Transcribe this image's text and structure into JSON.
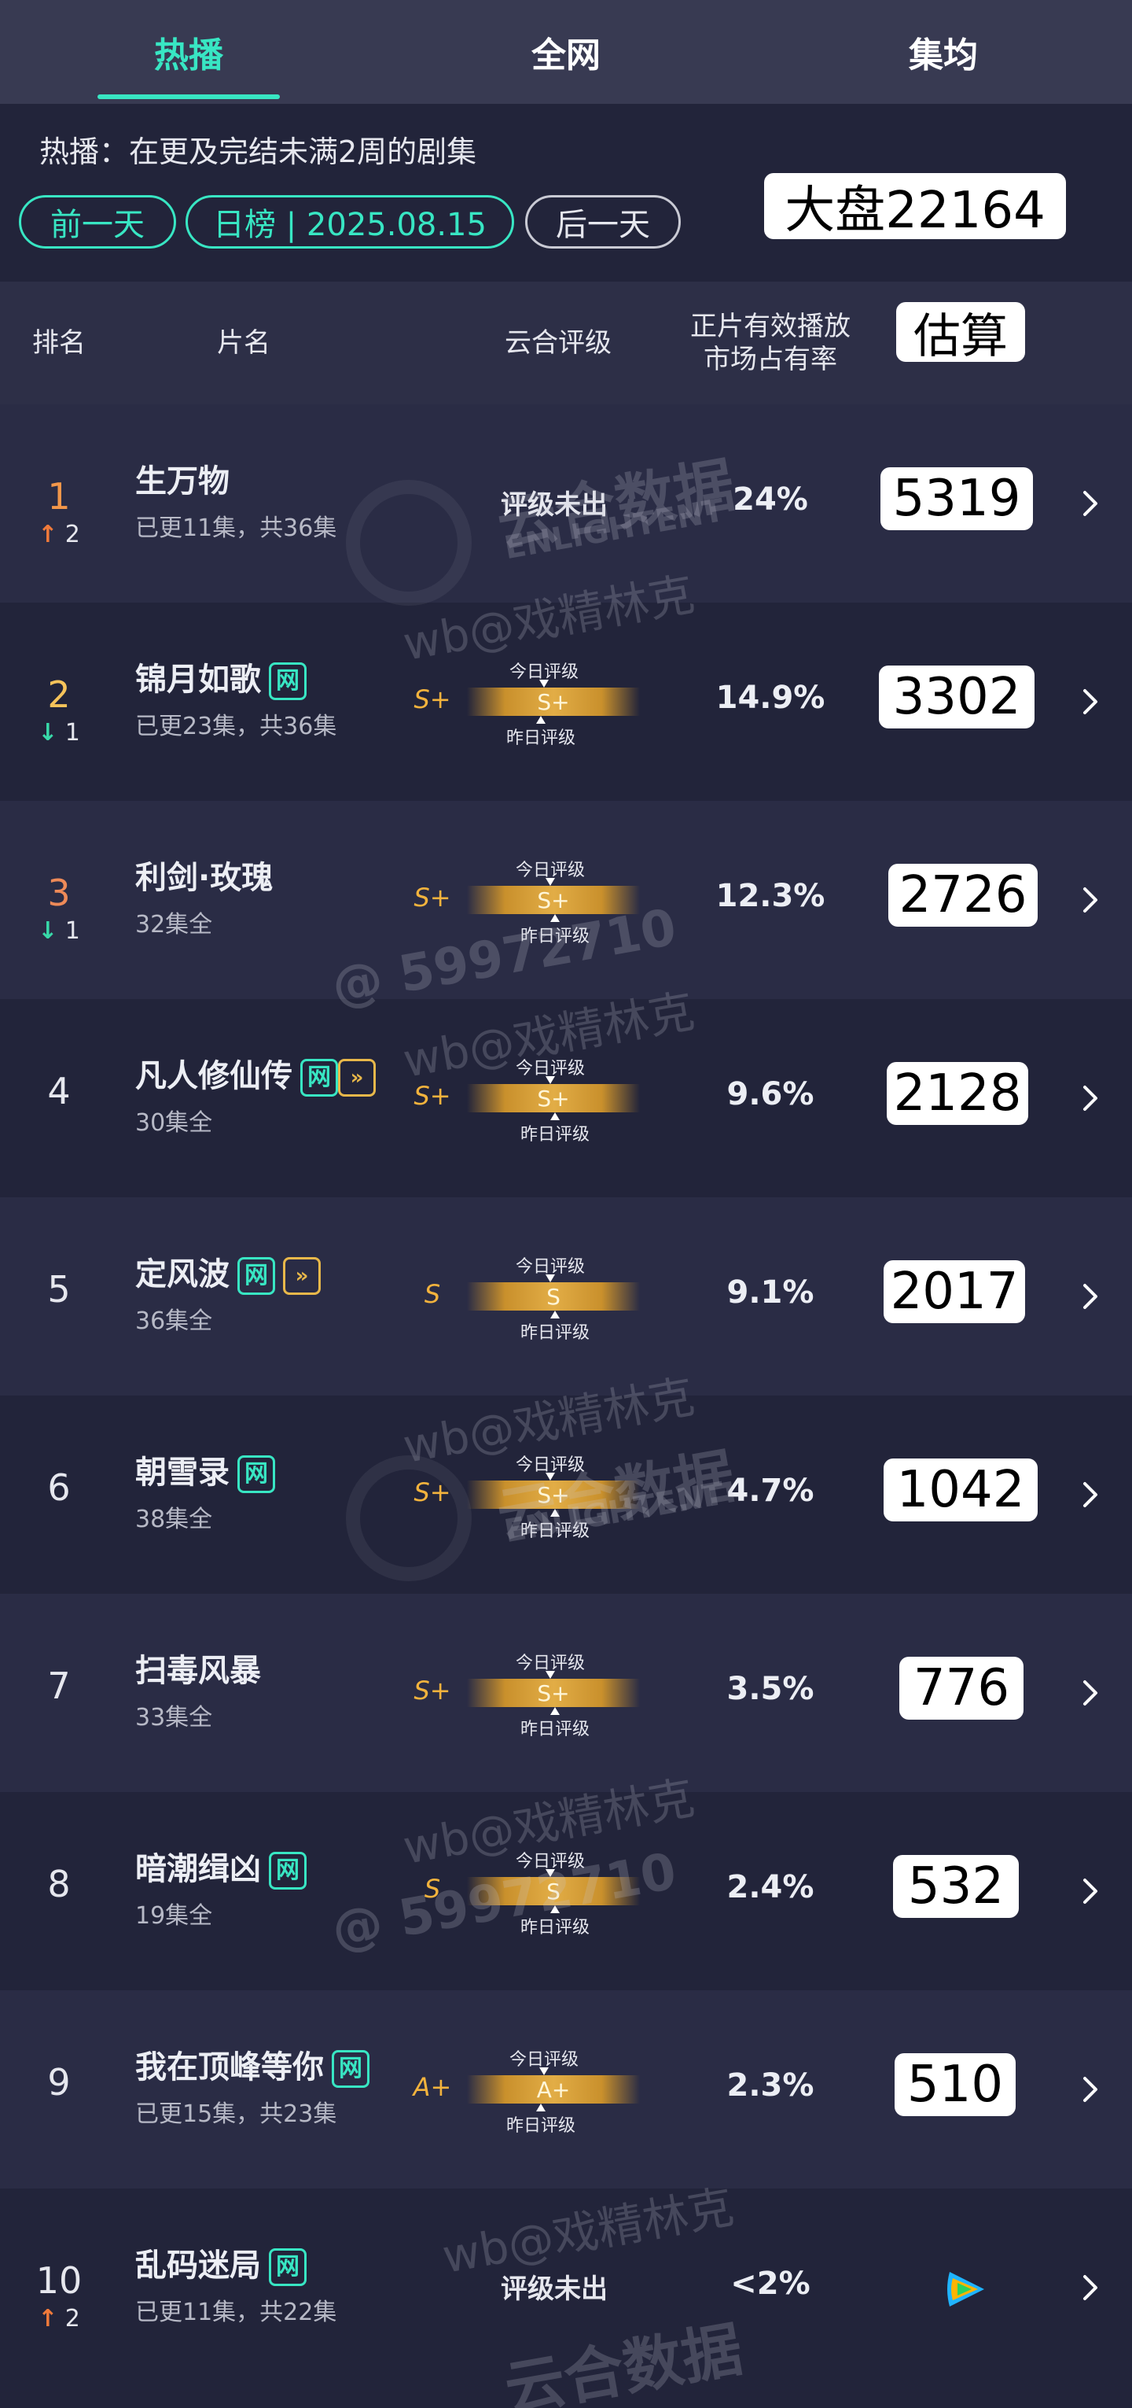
{
  "tabs": [
    {
      "label": "热播",
      "active": true
    },
    {
      "label": "全网",
      "active": false
    },
    {
      "label": "集均",
      "active": false
    }
  ],
  "info": {
    "subtitle": "热播：在更及完结未满2周的剧集",
    "prev_label": "前一天",
    "date_label": "日榜 | 2025.08.15",
    "next_label": "后一天",
    "total_overlay": "大盘22164"
  },
  "columns": {
    "rank": "排名",
    "name": "片名",
    "rating": "云合评级",
    "share": "正片有效播放\n市场占有率",
    "estimate_overlay": "估算"
  },
  "labels": {
    "today": "今日评级",
    "yesterday": "昨日评级"
  },
  "watermark": {
    "text": "wb@戏精林克",
    "brand": "云合数据",
    "brand_en": "ENLIGHTENT",
    "id_fragment": "@ 59972710"
  },
  "colors": {
    "accent": "#38e6c3",
    "rank_up": "#f07a3a",
    "rank_down": "#38d9a9",
    "grade": "#f3b33d"
  },
  "rows": [
    {
      "rank": "1",
      "change_dir": "up",
      "change": "2",
      "title": "生万物",
      "badges": [],
      "episodes": "已更11集，共36集",
      "rating": null,
      "no_rating": "评级未出",
      "share": "24%",
      "estimate": "5319"
    },
    {
      "rank": "2",
      "change_dir": "down",
      "change": "1",
      "title": "锦月如歌",
      "badges": [
        "网"
      ],
      "episodes": "已更23集，共36集",
      "rating": "S+",
      "share": "14.9%",
      "estimate": "3302"
    },
    {
      "rank": "3",
      "change_dir": "down",
      "change": "1",
      "title": "利剑·玫瑰",
      "badges": [],
      "episodes": "32集全",
      "rating": "S+",
      "share": "12.3%",
      "estimate": "2726"
    },
    {
      "rank": "4",
      "change_dir": "",
      "change": "",
      "title": "凡人修仙传",
      "badges": [
        "网",
        "play"
      ],
      "episodes": "30集全",
      "rating": "S+",
      "share": "9.6%",
      "estimate": "2128"
    },
    {
      "rank": "5",
      "change_dir": "",
      "change": "",
      "title": "定风波",
      "badges": [
        "网",
        "play"
      ],
      "episodes": "36集全",
      "rating": "S",
      "share": "9.1%",
      "estimate": "2017"
    },
    {
      "rank": "6",
      "change_dir": "",
      "change": "",
      "title": "朝雪录",
      "badges": [
        "网"
      ],
      "episodes": "38集全",
      "rating": "S+",
      "share": "4.7%",
      "estimate": "1042"
    },
    {
      "rank": "7",
      "change_dir": "",
      "change": "",
      "title": "扫毒风暴",
      "badges": [],
      "episodes": "33集全",
      "rating": "S+",
      "share": "3.5%",
      "estimate": "776"
    },
    {
      "rank": "8",
      "change_dir": "",
      "change": "",
      "title": "暗潮缉凶",
      "badges": [
        "网"
      ],
      "episodes": "19集全",
      "rating": "S",
      "share": "2.4%",
      "estimate": "532"
    },
    {
      "rank": "9",
      "change_dir": "",
      "change": "",
      "title": "我在顶峰等你",
      "badges": [
        "网"
      ],
      "episodes": "已更15集，共23集",
      "rating": "A+",
      "share": "2.3%",
      "estimate": "510"
    },
    {
      "rank": "10",
      "change_dir": "up",
      "change": "2",
      "title": "乱码迷局",
      "badges": [
        "网"
      ],
      "episodes": "已更11集，共22集",
      "rating": null,
      "no_rating": "评级未出",
      "share": "<2%",
      "estimate": null,
      "platform_icon": "tencent-video-icon"
    }
  ]
}
